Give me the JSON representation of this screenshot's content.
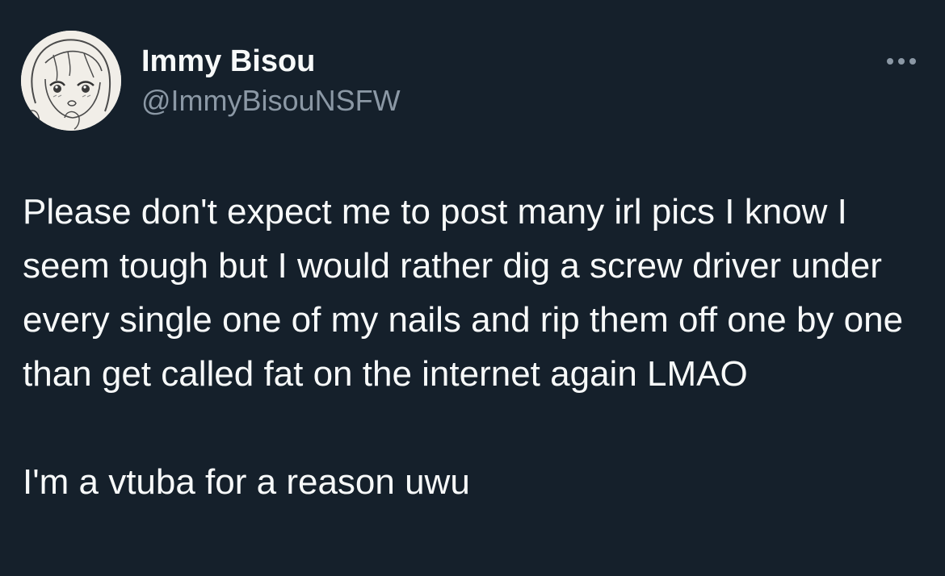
{
  "tweet": {
    "author": {
      "display_name": "Immy Bisou",
      "handle": "@ImmyBisouNSFW",
      "avatar_icon": "anime-girl-avatar-icon"
    },
    "more_icon": "more-options-icon",
    "paragraphs": [
      "Please don't expect me to post many irl pics I know I seem tough but I would rather dig a screw driver under every single one of my nails and rip them off one by one than get called fat on the internet again LMAO",
      "I'm a vtuba for a reason uwu"
    ]
  },
  "colors": {
    "background": "#15202b",
    "primary_text": "#f7f9f9",
    "secondary_text": "#8b98a5"
  }
}
